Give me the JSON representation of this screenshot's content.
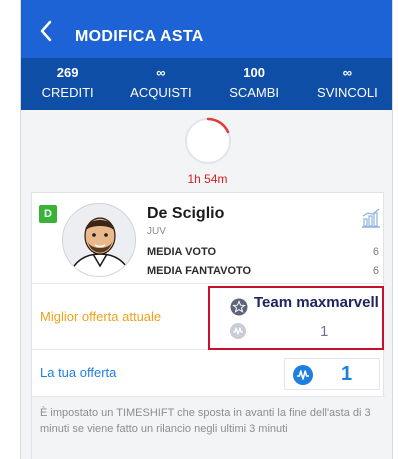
{
  "header": {
    "title": "MODIFICA ASTA",
    "back_icon": "chevron-left-icon"
  },
  "stats": [
    {
      "value": "269",
      "label": "CREDITI"
    },
    {
      "value": "∞",
      "label": "ACQUISTI"
    },
    {
      "value": "100",
      "label": "SCAMBI"
    },
    {
      "value": "∞",
      "label": "SVINCOLI"
    }
  ],
  "timer": {
    "text": "1h 54m",
    "color": "#d62020"
  },
  "player": {
    "role": "D",
    "role_color": "#38b338",
    "name": "De Sciglio",
    "team": "JUV",
    "media_voto_label": "MEDIA VOTO",
    "media_voto_value": "6",
    "media_fantavoto_label": "MEDIA FANTAVOTO",
    "media_fantavoto_value": "6"
  },
  "best_offer": {
    "label": "Miglior offerta attuale",
    "team_name": "Team maxmarvell",
    "value": "1"
  },
  "my_offer": {
    "label": "La tua offerta",
    "value": "1"
  },
  "note": "È impostato un TIMESHIFT che sposta in avanti la fine dell'asta di 3 minuti se viene fatto un rilancio negli ultimi 3 minuti",
  "colors": {
    "primary": "#1d63d5",
    "primary_dark": "#0f4ea7",
    "accent_orange": "#f0a21a",
    "accent_blue": "#1e7fe0",
    "highlight": "#c8102e"
  }
}
